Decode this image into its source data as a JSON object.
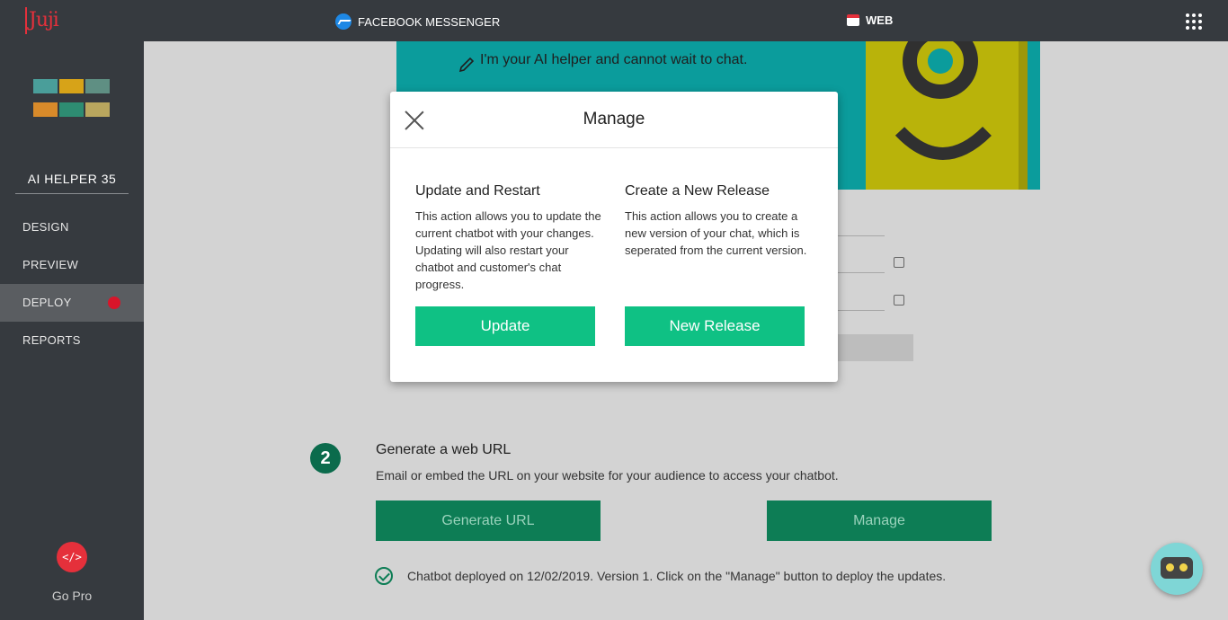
{
  "topbar": {
    "logo_text": "Juji",
    "channel_messenger": "FACEBOOK MESSENGER",
    "channel_web": "WEB"
  },
  "sidebar": {
    "bot_name": "AI HELPER 35",
    "items": [
      {
        "label": "DESIGN"
      },
      {
        "label": "PREVIEW"
      },
      {
        "label": "DEPLOY"
      },
      {
        "label": "REPORTS"
      }
    ],
    "gopro_icon_text": "</>",
    "gopro_label": "Go Pro"
  },
  "preview": {
    "helper_text": "I'm your AI helper and cannot wait to chat."
  },
  "step2": {
    "number": "2",
    "title": "Generate a web URL",
    "description": "Email or embed the URL on your website for your audience to access your chatbot.",
    "generate_label": "Generate URL",
    "manage_label": "Manage",
    "status": "Chatbot deployed on 12/02/2019. Version 1. Click on the \"Manage\" button to deploy the updates."
  },
  "modal": {
    "title": "Manage",
    "update": {
      "title": "Update and Restart",
      "description": "This action allows you to update the current chatbot with your changes. Updating will also restart your chatbot and customer's chat progress.",
      "button": "Update"
    },
    "release": {
      "title": "Create a New Release",
      "description": "This action allows you to create a new version of your chat, which is seperated from the current version.",
      "button": "New Release"
    }
  },
  "colors": {
    "accent_green": "#0fc184",
    "dark_green": "#0d7d55",
    "sidebar_bg": "#363a3f",
    "alert_red": "#d8152a"
  }
}
